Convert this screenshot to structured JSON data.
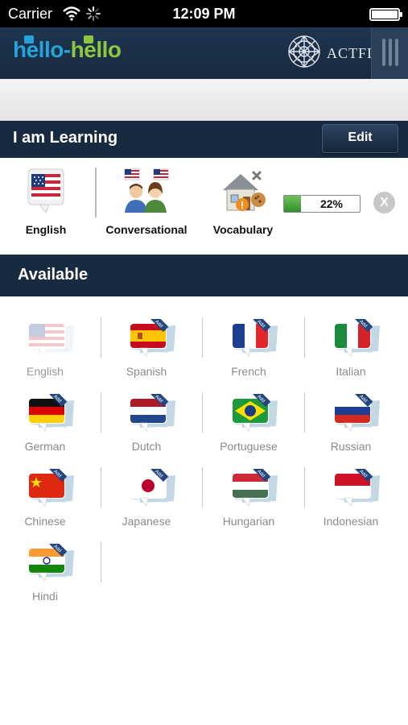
{
  "status_bar": {
    "carrier": "Carrier",
    "time": "12:09 PM"
  },
  "header": {
    "logo_part1": "hello",
    "logo_dash": "-",
    "logo_part2": "hello",
    "partner_text": "ACTFL",
    "colors": {
      "background": "#1f3550",
      "logo_blue": "#27a3d9",
      "logo_green": "#8ec63f"
    }
  },
  "learning_section": {
    "title": "I am Learning",
    "edit_label": "Edit",
    "items": [
      {
        "label": "English",
        "icon": "us-flag-bubble-icon"
      },
      {
        "label": "Conversational",
        "icon": "conversation-people-icon"
      },
      {
        "label": "Vocabulary",
        "icon": "vocabulary-house-icon"
      }
    ],
    "progress": {
      "text": "22%",
      "value": 0.22,
      "color": "#3aa33a"
    },
    "close_label": "X"
  },
  "available_section": {
    "title": "Available",
    "languages": [
      {
        "name": "English",
        "flag": "us",
        "enabled": false
      },
      {
        "name": "Spanish",
        "flag": "es",
        "enabled": true
      },
      {
        "name": "French",
        "flag": "fr",
        "enabled": true
      },
      {
        "name": "Italian",
        "flag": "it",
        "enabled": true
      },
      {
        "name": "German",
        "flag": "de",
        "enabled": true
      },
      {
        "name": "Dutch",
        "flag": "nl",
        "enabled": true
      },
      {
        "name": "Portuguese",
        "flag": "br",
        "enabled": true
      },
      {
        "name": "Russian",
        "flag": "ru",
        "enabled": true
      },
      {
        "name": "Chinese",
        "flag": "cn",
        "enabled": true
      },
      {
        "name": "Japanese",
        "flag": "jp",
        "enabled": true
      },
      {
        "name": "Hungarian",
        "flag": "hu",
        "enabled": true
      },
      {
        "name": "Indonesian",
        "flag": "id",
        "enabled": true
      },
      {
        "name": "Hindi",
        "flag": "in",
        "enabled": true
      }
    ],
    "badge_text": "Add"
  }
}
